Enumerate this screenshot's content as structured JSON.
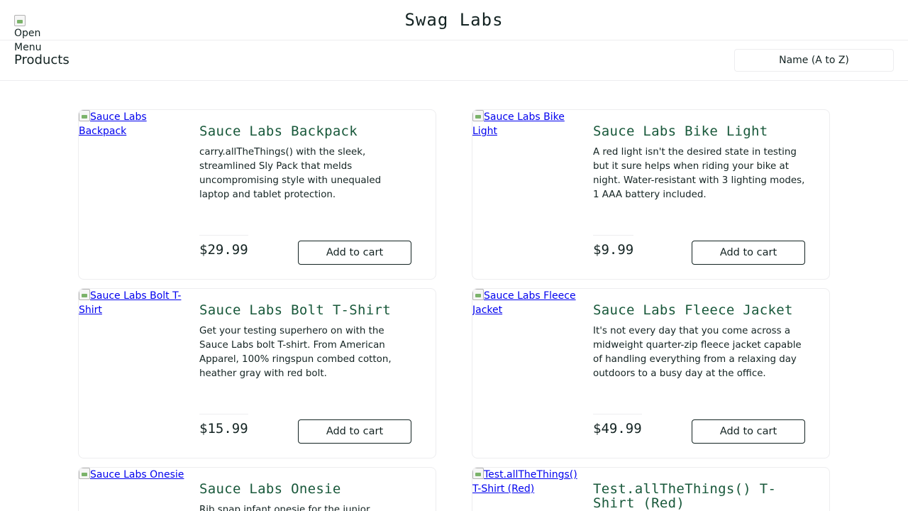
{
  "header": {
    "menu_label": "Open Menu",
    "logo": "Swag Labs"
  },
  "secondary": {
    "title": "Products",
    "sort_selected": "Name (A to Z)"
  },
  "products": [
    {
      "image_alt": "Sauce Labs Backpack",
      "name": "Sauce Labs Backpack",
      "description": "carry.allTheThings() with the sleek, streamlined Sly Pack that melds uncompromising style with unequaled laptop and tablet protection.",
      "price": "$29.99",
      "button": "Add to cart"
    },
    {
      "image_alt": "Sauce Labs Bike Light",
      "name": "Sauce Labs Bike Light",
      "description": "A red light isn't the desired state in testing but it sure helps when riding your bike at night. Water-resistant with 3 lighting modes, 1 AAA battery included.",
      "price": "$9.99",
      "button": "Add to cart"
    },
    {
      "image_alt": "Sauce Labs Bolt T-Shirt",
      "name": "Sauce Labs Bolt T-Shirt",
      "description": "Get your testing superhero on with the Sauce Labs bolt T-shirt. From American Apparel, 100% ringspun combed cotton, heather gray with red bolt.",
      "price": "$15.99",
      "button": "Add to cart"
    },
    {
      "image_alt": "Sauce Labs Fleece Jacket",
      "name": "Sauce Labs Fleece Jacket",
      "description": "It's not every day that you come across a midweight quarter-zip fleece jacket capable of handling everything from a relaxing day outdoors to a busy day at the office.",
      "price": "$49.99",
      "button": "Add to cart"
    },
    {
      "image_alt": "Sauce Labs Onesie",
      "name": "Sauce Labs Onesie",
      "description": "Rib snap infant onesie for the junior",
      "price": "",
      "button": ""
    },
    {
      "image_alt": "Test.allTheThings() T-Shirt (Red)",
      "name": "Test.allTheThings() T-Shirt (Red)",
      "description": "",
      "price": "",
      "button": ""
    }
  ],
  "colors": {
    "product_name": "#18583a",
    "text": "#132322",
    "border": "#ededef",
    "link": "#0000ee"
  }
}
